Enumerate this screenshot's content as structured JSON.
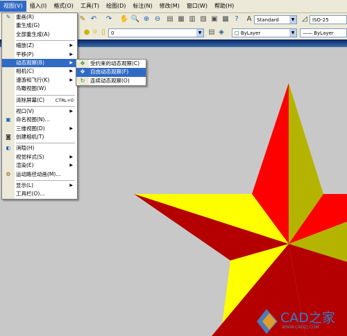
{
  "menubar": {
    "items": [
      {
        "label": "视图(V)",
        "active": true
      },
      {
        "label": "插入(I)"
      },
      {
        "label": "格式(O)"
      },
      {
        "label": "工具(T)"
      },
      {
        "label": "绘图(D)"
      },
      {
        "label": "标注(N)"
      },
      {
        "label": "修改(M)"
      },
      {
        "label": "窗口(W)"
      },
      {
        "label": "帮助(H)"
      }
    ]
  },
  "toolbar": {
    "text_style": "Standard",
    "dim_style": "ISO-25",
    "layer": "0",
    "color_control": "ByLayer",
    "linetype_control": "ByLayer"
  },
  "view_menu": {
    "items": [
      {
        "label": "重画(R)"
      },
      {
        "label": "重生成(G)"
      },
      {
        "label": "全部重生成(A)"
      },
      {
        "separator": true
      },
      {
        "label": "缩放(Z)",
        "submenu": true
      },
      {
        "label": "平移(P)",
        "submenu": true
      },
      {
        "label": "动态观察(B)",
        "submenu": true,
        "highlighted": true
      },
      {
        "label": "相机(C)",
        "submenu": true
      },
      {
        "label": "漫游和飞行(K)",
        "submenu": true
      },
      {
        "label": "鸟瞰视图(W)"
      },
      {
        "separator": true
      },
      {
        "label": "清除屏幕(C)",
        "shortcut": "CTRL+0"
      },
      {
        "separator": true
      },
      {
        "label": "视口(V)",
        "submenu": true
      },
      {
        "label": "命名视图(N)..."
      },
      {
        "label": "三维视图(D)",
        "submenu": true
      },
      {
        "label": "创建相机(T)"
      },
      {
        "separator": true
      },
      {
        "label": "消隐(H)"
      },
      {
        "label": "视觉样式(S)",
        "submenu": true
      },
      {
        "label": "渲染(E)",
        "submenu": true
      },
      {
        "label": "运动路径动画(M)..."
      },
      {
        "separator": true
      },
      {
        "label": "显示(L)",
        "submenu": true
      },
      {
        "label": "工具栏(O)..."
      }
    ]
  },
  "orbit_submenu": {
    "items": [
      {
        "label": "受约束的动态观察(C)"
      },
      {
        "label": "自由动态观察(F)",
        "highlighted": true
      },
      {
        "label": "连续动态观察(O)"
      }
    ]
  },
  "watermark": {
    "brand": "CAD之家",
    "url": "WWW.CADZJ.COM"
  },
  "colors": {
    "star_red": "#ff0000",
    "star_dark_red": "#b40000",
    "star_yellow": "#ffff00",
    "star_olive": "#b4b400",
    "background": "#c8c8c8",
    "menu_highlight": "#316ac5"
  }
}
